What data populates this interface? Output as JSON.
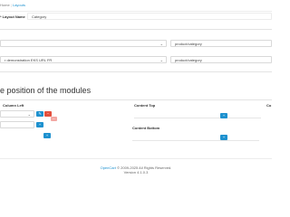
{
  "breadcrumb": {
    "home": "Home",
    "separator": "|",
    "current": "Layouts"
  },
  "form": {
    "layout_name_label": "* Layout Name",
    "layout_name_value": "Category",
    "route_rows": [
      {
        "store": "",
        "route": "product/category"
      },
      {
        "store": "r demonstration EKS URL FR",
        "route": "product/category"
      }
    ]
  },
  "modules_section": {
    "heading": "e position of the modules"
  },
  "columns": {
    "column_left": "Column Left",
    "content_top": "Content Top",
    "content_bottom": "Content Bottom",
    "column_right_partial": "Co"
  },
  "icons": {
    "edit": "pencil-icon",
    "remove": "minus-circle-icon",
    "add": "plus-circle-icon",
    "select": "chevron-down-icon"
  },
  "colors": {
    "primary": "#1e91cf",
    "danger": "#e3503e",
    "link": "#1e91cf"
  },
  "footer": {
    "brand": "OpenCart",
    "copyright": "© 2009-2025 All Rights Reserved.",
    "version": "Version 4.1.0.3"
  }
}
